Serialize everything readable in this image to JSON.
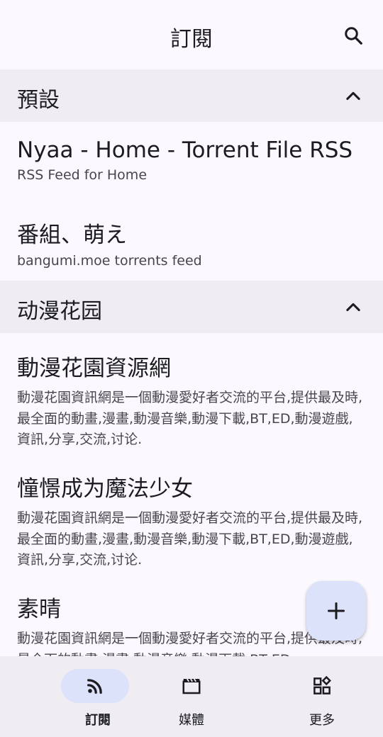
{
  "header": {
    "title": "訂閱",
    "search_icon": "search-icon"
  },
  "groups": [
    {
      "name": "預設",
      "expanded": true,
      "feeds": [
        {
          "title": "Nyaa - Home - Torrent File RSS",
          "desc": "RSS Feed for Home"
        },
        {
          "title": "番組、萌え",
          "desc": "bangumi.moe torrents feed"
        }
      ]
    },
    {
      "name": "动漫花园",
      "expanded": true,
      "feeds": [
        {
          "title": "動漫花園資源網",
          "desc": "動漫花園資訊網是一個動漫愛好者交流的平台,提供最及時,最全面的動畫,漫畫,動漫音樂,動漫下載,BT,ED,動漫遊戲,資訊,分享,交流,讨论."
        },
        {
          "title": "憧憬成为魔法少女",
          "desc": "動漫花園資訊網是一個動漫愛好者交流的平台,提供最及時,最全面的動畫,漫畫,動漫音樂,動漫下載,BT,ED,動漫遊戲,資訊,分享,交流,讨论."
        },
        {
          "title": "素晴",
          "desc": "動漫花園資訊網是一個動漫愛好者交流的平台,提供最及時,最全面的動畫,漫畫,動漫音樂,動漫下載,BT,ED"
        }
      ]
    }
  ],
  "fab": {
    "icon": "plus-icon"
  },
  "bottom_nav": [
    {
      "label": "訂閱",
      "icon": "rss-icon",
      "active": true
    },
    {
      "label": "媒體",
      "icon": "clapperboard-icon",
      "active": false
    },
    {
      "label": "更多",
      "icon": "widgets-icon",
      "active": false
    }
  ],
  "colors": {
    "background": "#fbf9fd",
    "section_header": "#efedf1",
    "accent_container": "#dbe2f9",
    "text_primary": "#1c1b1f",
    "text_secondary": "#49454f"
  }
}
